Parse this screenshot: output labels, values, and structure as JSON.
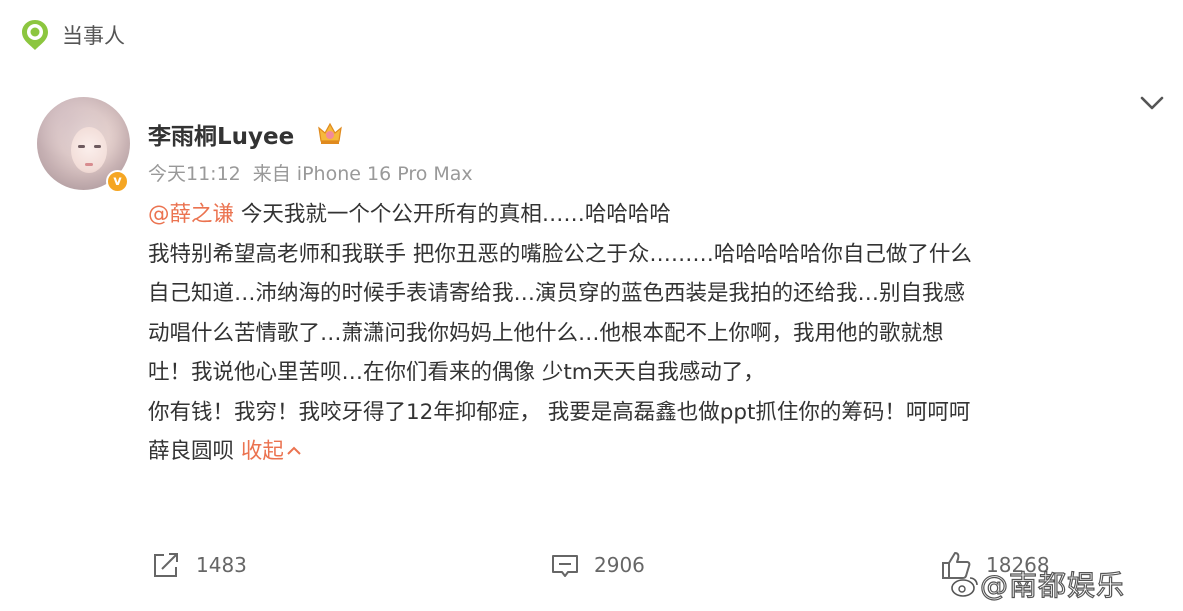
{
  "header": {
    "tag_label": "当事人",
    "tag_icon": "location-tag-icon"
  },
  "post": {
    "username": "李雨桐Luyee",
    "time": "今天11:12",
    "source": "来自 iPhone 16 Pro Max",
    "mention": "@薛之谦",
    "lines": [
      " 今天我就一个个公开所有的真相……哈哈哈哈",
      "我特别希望高老师和我联手 把你丑恶的嘴脸公之于众………哈哈哈哈哈你自己做了什么",
      "自己知道…沛纳海的时候手表请寄给我…演员穿的蓝色西装是我拍的还给我…别自我感",
      "动唱什么苦情歌了…萧潇问我你妈妈上他什么…他根本配不上你啊，我用他的歌就想",
      "吐！我说他心里苦呗…在你们看来的偶像 少tm天天自我感动了，",
      "你有钱！我穷！我咬牙得了12年抑郁症， 我要是高磊鑫也做ppt抓住你的筹码！呵呵呵",
      "薛良圆呗 "
    ],
    "collapse_label": "收起",
    "verified_mark": "v"
  },
  "actions": {
    "repost_count": "1483",
    "comment_count": "2906",
    "like_count": "18268"
  },
  "watermark": "@南都娱乐",
  "colors": {
    "accent": "#eb7350",
    "text": "#333333",
    "meta": "#999999",
    "verified": "#f5a623"
  }
}
